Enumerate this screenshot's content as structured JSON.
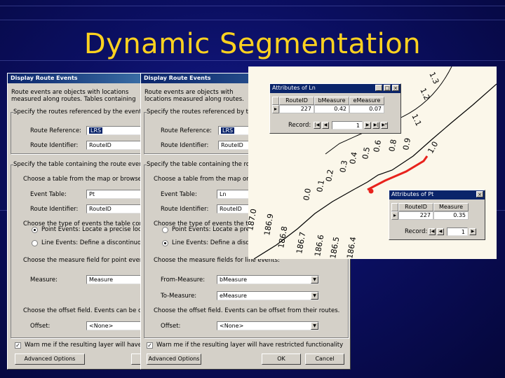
{
  "slide": {
    "title": "Dynamic Segmentation",
    "background_color": "#0b0f62",
    "title_color": "#ffd21f"
  },
  "dialogs": [
    {
      "title": "Display Route Events",
      "intro": "Route events are objects with locations measured along routes. Tables containing route events can be added to the map.",
      "step_routes": "Specify the routes referenced by the events in the table:",
      "route_reference_label": "Route Reference:",
      "route_reference_value": "LRS",
      "route_identifier_label": "Route Identifier:",
      "route_identifier_value": "RouteID",
      "step_table": "Specify the table containing the route events:",
      "choose_table": "Choose a table from the map or browse for another table:",
      "event_table_label": "Event Table:",
      "event_table_value": "Pt",
      "event_route_id_label": "Route Identifier:",
      "event_route_id_value": "RouteID",
      "choose_type": "Choose the type of events the table contains:",
      "point_events": "Point Events: Locate a precise location",
      "line_events": "Line Events: Define a discontinuous portion",
      "point_selected": true,
      "measure_section": "Choose the measure field for point events:",
      "measure_label": "Measure:",
      "measure_value": "Measure",
      "to_measure_label": "",
      "to_measure_value": "",
      "offset_section": "Choose the offset field. Events can be offset from their routes.",
      "offset_label": "Offset:",
      "offset_value": "<None>",
      "warn_text": "Warn me if the resulting layer will have restricted functionality",
      "advanced_label": "Advanced Options",
      "ok_label": "",
      "cancel_label": ""
    },
    {
      "title": "Display Route Events",
      "intro": "Route events are objects with locations measured along routes. Tables containing route events can be added to the map.",
      "step_routes": "Specify the routes referenced by the events in the table:",
      "route_reference_label": "Route Reference:",
      "route_reference_value": "LRS",
      "route_identifier_label": "Route Identifier:",
      "route_identifier_value": "RouteID",
      "step_table": "Specify the table containing the route events:",
      "choose_table": "Choose a table from the map or browse for another table:",
      "event_table_label": "Event Table:",
      "event_table_value": "Ln",
      "event_route_id_label": "Route Identifier:",
      "event_route_id_value": "RouteID",
      "choose_type": "Choose the type of events the table contains:",
      "point_events": "Point Events: Locate a precise location",
      "line_events": "Line Events: Define a discontinuous portion",
      "point_selected": false,
      "measure_section": "Choose the measure fields for line events:",
      "measure_label": "From-Measure:",
      "measure_value": "bMeasure",
      "to_measure_label": "To-Measure:",
      "to_measure_value": "eMeasure",
      "offset_section": "Choose the offset field. Events can be offset from their routes.",
      "offset_label": "Offset:",
      "offset_value": "<None>",
      "warn_text": "Warn me if the resulting layer will have restricted functionality",
      "advanced_label": "Advanced Options",
      "ok_label": "OK",
      "cancel_label": "Cancel"
    }
  ],
  "attributes_ln": {
    "title": "Attributes of Ln",
    "columns": [
      "RouteID",
      "bMeasure",
      "eMeasure"
    ],
    "row": [
      "227",
      "0.42",
      "0.07"
    ],
    "record_label": "Record:",
    "record_value": "1"
  },
  "attributes_pt": {
    "title": "Attributes of Pt",
    "columns": [
      "RouteID",
      "Measure"
    ],
    "row": [
      "227",
      "0.35"
    ],
    "record_label": "Record:",
    "record_value": "1"
  },
  "map_labels": [
    "1.3",
    "1.2",
    "1.1",
    "0.9",
    "0.8",
    "0.6",
    "0.5",
    "0.4",
    "0.3",
    "0.2",
    "0.1",
    "0.0",
    "187.0",
    "186.9",
    "186.8",
    "186.7",
    "186.6",
    "186.5",
    "186.4",
    "1.0"
  ],
  "colors": {
    "route_highlight": "#e8221c",
    "map_bg": "#fbf7ea",
    "dialog_bg": "#d4d0c8",
    "titlebar": "#0a246a"
  }
}
